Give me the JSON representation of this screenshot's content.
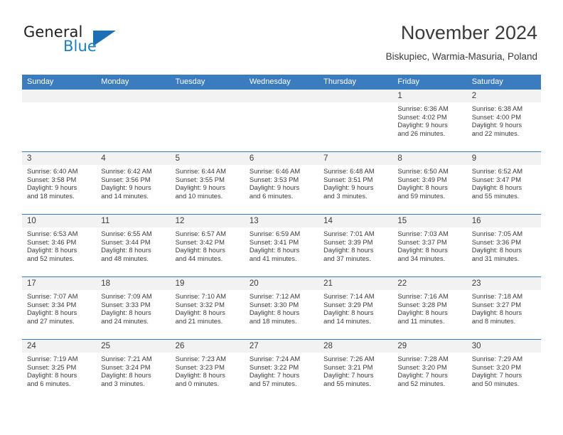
{
  "brand": {
    "line1": "General",
    "line2": "Blue",
    "triangle_color": "#1b6fb5",
    "text_color": "#231f20",
    "accent_color": "#1c7fc4"
  },
  "header": {
    "title": "November 2024",
    "subtitle": "Biskupiec, Warmia-Masuria, Poland"
  },
  "theme": {
    "header_blue": "#3a7cbe",
    "date_band_gray": "#f2f2f2",
    "text": "#3b3b3b"
  },
  "weekdays": [
    "Sunday",
    "Monday",
    "Tuesday",
    "Wednesday",
    "Thursday",
    "Friday",
    "Saturday"
  ],
  "weeks": [
    {
      "dates": [
        "",
        "",
        "",
        "",
        "",
        "1",
        "2"
      ],
      "cells": [
        {
          "empty": true,
          "l1": "",
          "l2": "",
          "l3": "",
          "l4": ""
        },
        {
          "empty": true,
          "l1": "",
          "l2": "",
          "l3": "",
          "l4": ""
        },
        {
          "empty": true,
          "l1": "",
          "l2": "",
          "l3": "",
          "l4": ""
        },
        {
          "empty": true,
          "l1": "",
          "l2": "",
          "l3": "",
          "l4": ""
        },
        {
          "empty": true,
          "l1": "",
          "l2": "",
          "l3": "",
          "l4": ""
        },
        {
          "empty": false,
          "l1": "Sunrise: 6:36 AM",
          "l2": "Sunset: 4:02 PM",
          "l3": "Daylight: 9 hours",
          "l4": "and 26 minutes."
        },
        {
          "empty": false,
          "l1": "Sunrise: 6:38 AM",
          "l2": "Sunset: 4:00 PM",
          "l3": "Daylight: 9 hours",
          "l4": "and 22 minutes."
        }
      ]
    },
    {
      "dates": [
        "3",
        "4",
        "5",
        "6",
        "7",
        "8",
        "9"
      ],
      "cells": [
        {
          "empty": false,
          "l1": "Sunrise: 6:40 AM",
          "l2": "Sunset: 3:58 PM",
          "l3": "Daylight: 9 hours",
          "l4": "and 18 minutes."
        },
        {
          "empty": false,
          "l1": "Sunrise: 6:42 AM",
          "l2": "Sunset: 3:56 PM",
          "l3": "Daylight: 9 hours",
          "l4": "and 14 minutes."
        },
        {
          "empty": false,
          "l1": "Sunrise: 6:44 AM",
          "l2": "Sunset: 3:55 PM",
          "l3": "Daylight: 9 hours",
          "l4": "and 10 minutes."
        },
        {
          "empty": false,
          "l1": "Sunrise: 6:46 AM",
          "l2": "Sunset: 3:53 PM",
          "l3": "Daylight: 9 hours",
          "l4": "and 6 minutes."
        },
        {
          "empty": false,
          "l1": "Sunrise: 6:48 AM",
          "l2": "Sunset: 3:51 PM",
          "l3": "Daylight: 9 hours",
          "l4": "and 3 minutes."
        },
        {
          "empty": false,
          "l1": "Sunrise: 6:50 AM",
          "l2": "Sunset: 3:49 PM",
          "l3": "Daylight: 8 hours",
          "l4": "and 59 minutes."
        },
        {
          "empty": false,
          "l1": "Sunrise: 6:52 AM",
          "l2": "Sunset: 3:47 PM",
          "l3": "Daylight: 8 hours",
          "l4": "and 55 minutes."
        }
      ]
    },
    {
      "dates": [
        "10",
        "11",
        "12",
        "13",
        "14",
        "15",
        "16"
      ],
      "cells": [
        {
          "empty": false,
          "l1": "Sunrise: 6:53 AM",
          "l2": "Sunset: 3:46 PM",
          "l3": "Daylight: 8 hours",
          "l4": "and 52 minutes."
        },
        {
          "empty": false,
          "l1": "Sunrise: 6:55 AM",
          "l2": "Sunset: 3:44 PM",
          "l3": "Daylight: 8 hours",
          "l4": "and 48 minutes."
        },
        {
          "empty": false,
          "l1": "Sunrise: 6:57 AM",
          "l2": "Sunset: 3:42 PM",
          "l3": "Daylight: 8 hours",
          "l4": "and 44 minutes."
        },
        {
          "empty": false,
          "l1": "Sunrise: 6:59 AM",
          "l2": "Sunset: 3:41 PM",
          "l3": "Daylight: 8 hours",
          "l4": "and 41 minutes."
        },
        {
          "empty": false,
          "l1": "Sunrise: 7:01 AM",
          "l2": "Sunset: 3:39 PM",
          "l3": "Daylight: 8 hours",
          "l4": "and 37 minutes."
        },
        {
          "empty": false,
          "l1": "Sunrise: 7:03 AM",
          "l2": "Sunset: 3:37 PM",
          "l3": "Daylight: 8 hours",
          "l4": "and 34 minutes."
        },
        {
          "empty": false,
          "l1": "Sunrise: 7:05 AM",
          "l2": "Sunset: 3:36 PM",
          "l3": "Daylight: 8 hours",
          "l4": "and 31 minutes."
        }
      ]
    },
    {
      "dates": [
        "17",
        "18",
        "19",
        "20",
        "21",
        "22",
        "23"
      ],
      "cells": [
        {
          "empty": false,
          "l1": "Sunrise: 7:07 AM",
          "l2": "Sunset: 3:34 PM",
          "l3": "Daylight: 8 hours",
          "l4": "and 27 minutes."
        },
        {
          "empty": false,
          "l1": "Sunrise: 7:09 AM",
          "l2": "Sunset: 3:33 PM",
          "l3": "Daylight: 8 hours",
          "l4": "and 24 minutes."
        },
        {
          "empty": false,
          "l1": "Sunrise: 7:10 AM",
          "l2": "Sunset: 3:32 PM",
          "l3": "Daylight: 8 hours",
          "l4": "and 21 minutes."
        },
        {
          "empty": false,
          "l1": "Sunrise: 7:12 AM",
          "l2": "Sunset: 3:30 PM",
          "l3": "Daylight: 8 hours",
          "l4": "and 18 minutes."
        },
        {
          "empty": false,
          "l1": "Sunrise: 7:14 AM",
          "l2": "Sunset: 3:29 PM",
          "l3": "Daylight: 8 hours",
          "l4": "and 14 minutes."
        },
        {
          "empty": false,
          "l1": "Sunrise: 7:16 AM",
          "l2": "Sunset: 3:28 PM",
          "l3": "Daylight: 8 hours",
          "l4": "and 11 minutes."
        },
        {
          "empty": false,
          "l1": "Sunrise: 7:18 AM",
          "l2": "Sunset: 3:27 PM",
          "l3": "Daylight: 8 hours",
          "l4": "and 8 minutes."
        }
      ]
    },
    {
      "dates": [
        "24",
        "25",
        "26",
        "27",
        "28",
        "29",
        "30"
      ],
      "cells": [
        {
          "empty": false,
          "l1": "Sunrise: 7:19 AM",
          "l2": "Sunset: 3:25 PM",
          "l3": "Daylight: 8 hours",
          "l4": "and 6 minutes."
        },
        {
          "empty": false,
          "l1": "Sunrise: 7:21 AM",
          "l2": "Sunset: 3:24 PM",
          "l3": "Daylight: 8 hours",
          "l4": "and 3 minutes."
        },
        {
          "empty": false,
          "l1": "Sunrise: 7:23 AM",
          "l2": "Sunset: 3:23 PM",
          "l3": "Daylight: 8 hours",
          "l4": "and 0 minutes."
        },
        {
          "empty": false,
          "l1": "Sunrise: 7:24 AM",
          "l2": "Sunset: 3:22 PM",
          "l3": "Daylight: 7 hours",
          "l4": "and 57 minutes."
        },
        {
          "empty": false,
          "l1": "Sunrise: 7:26 AM",
          "l2": "Sunset: 3:21 PM",
          "l3": "Daylight: 7 hours",
          "l4": "and 55 minutes."
        },
        {
          "empty": false,
          "l1": "Sunrise: 7:28 AM",
          "l2": "Sunset: 3:20 PM",
          "l3": "Daylight: 7 hours",
          "l4": "and 52 minutes."
        },
        {
          "empty": false,
          "l1": "Sunrise: 7:29 AM",
          "l2": "Sunset: 3:20 PM",
          "l3": "Daylight: 7 hours",
          "l4": "and 50 minutes."
        }
      ]
    }
  ]
}
